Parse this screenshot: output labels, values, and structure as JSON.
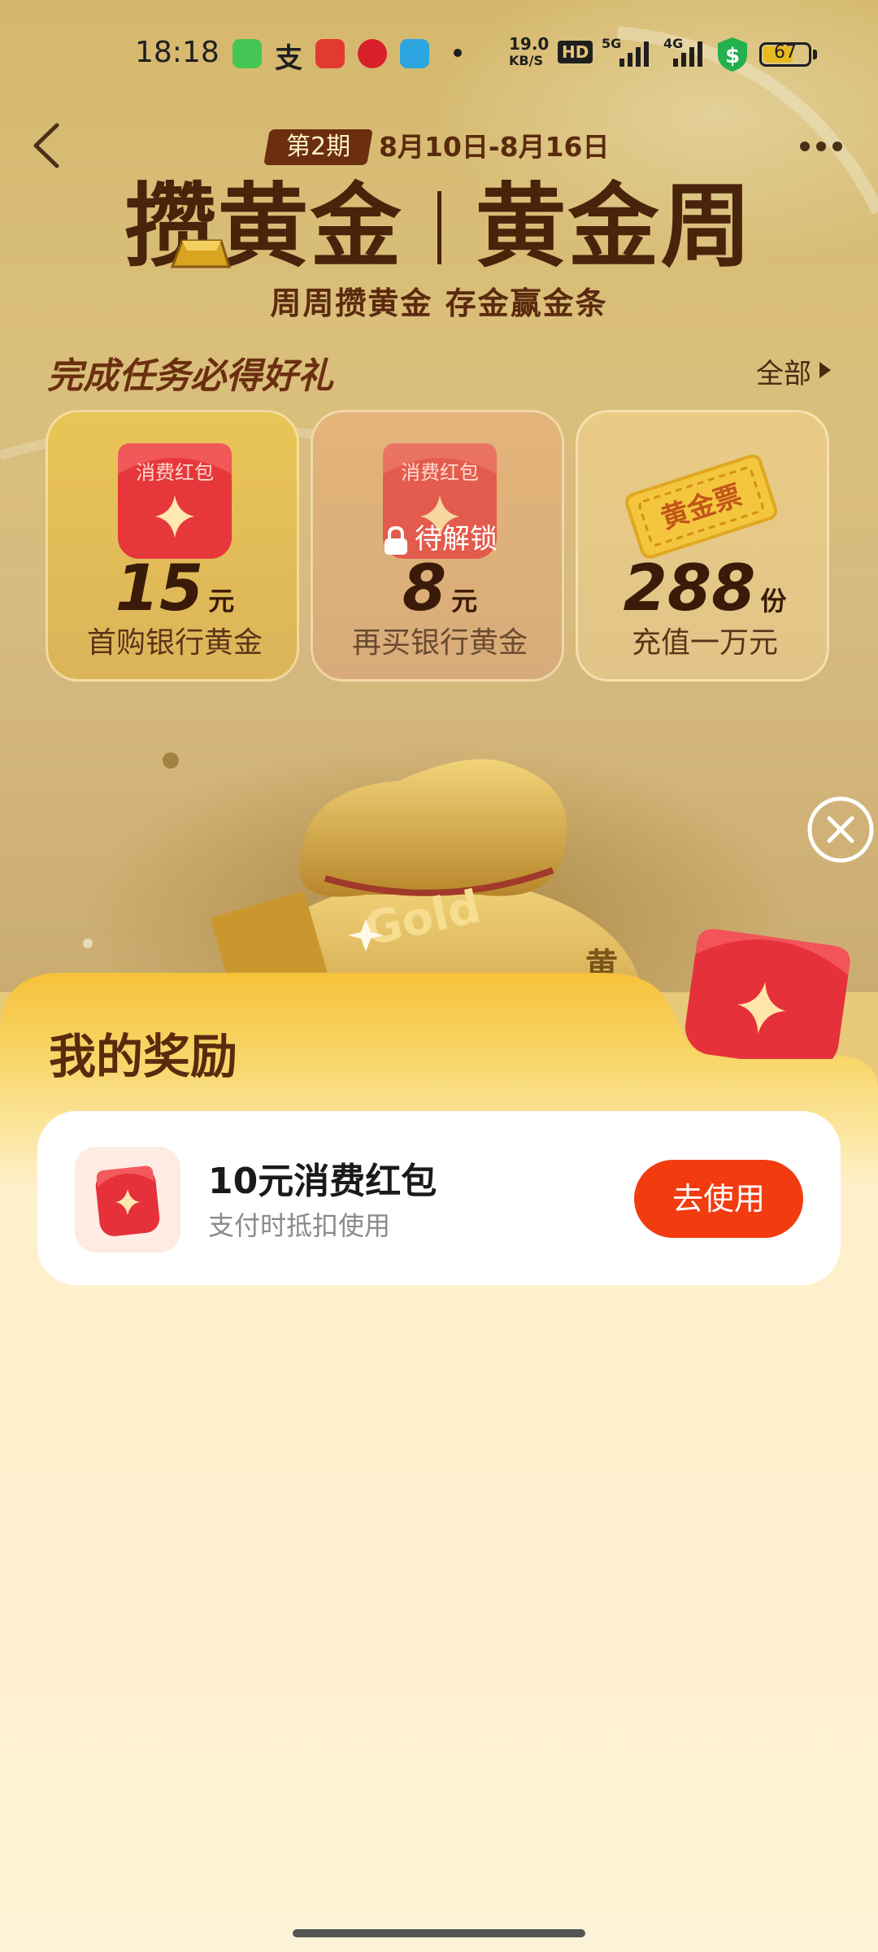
{
  "status_bar": {
    "time": "18:18",
    "net_speed_value": "19.0",
    "net_speed_unit": "KB/S",
    "hd_label": "HD",
    "signal_5g": "5G",
    "signal_4g": "4G",
    "battery_level": "67",
    "battery_fraction": 0.67,
    "icons": [
      "messages-icon",
      "alipay-icon",
      "unionpay-icon",
      "cmb-bank-icon",
      "telegram-icon",
      "dot-icon",
      "hd-icon",
      "signal-5g-icon",
      "signal-4g-icon",
      "dollar-shield-icon",
      "battery-icon"
    ]
  },
  "header": {
    "period": "第2期",
    "dates": "8月10日-8月16日",
    "title_left": "攒黄金",
    "title_right": "黄金周",
    "subtitle": "周周攒黄金 存金赢金条"
  },
  "tasks": {
    "heading": "完成任务必得好礼",
    "all_label": "全部",
    "cards": [
      {
        "envelope_label": "消费红包",
        "value": "15",
        "unit": "元",
        "desc": "首购银行黄金",
        "locked": false
      },
      {
        "envelope_label": "消费红包",
        "lock_label": "待解锁",
        "value": "8",
        "unit": "元",
        "desc": "再买银行黄金",
        "locked": true
      },
      {
        "ticket_label": "黄金票",
        "value": "288",
        "unit": "份",
        "desc": "充值一万元",
        "locked": false
      }
    ]
  },
  "decor": {
    "bag_text": "Gold",
    "bag_char": "黄"
  },
  "rewards": {
    "title": "我的奖励",
    "items": [
      {
        "name": "10元消费红包",
        "note": "支付时抵扣使用",
        "button": "去使用"
      }
    ]
  },
  "colors": {
    "accent_button": "#f23c10",
    "title_brown": "#4a230b",
    "sheet_bg": "#fff2d3",
    "gold": "#e9c46a"
  }
}
